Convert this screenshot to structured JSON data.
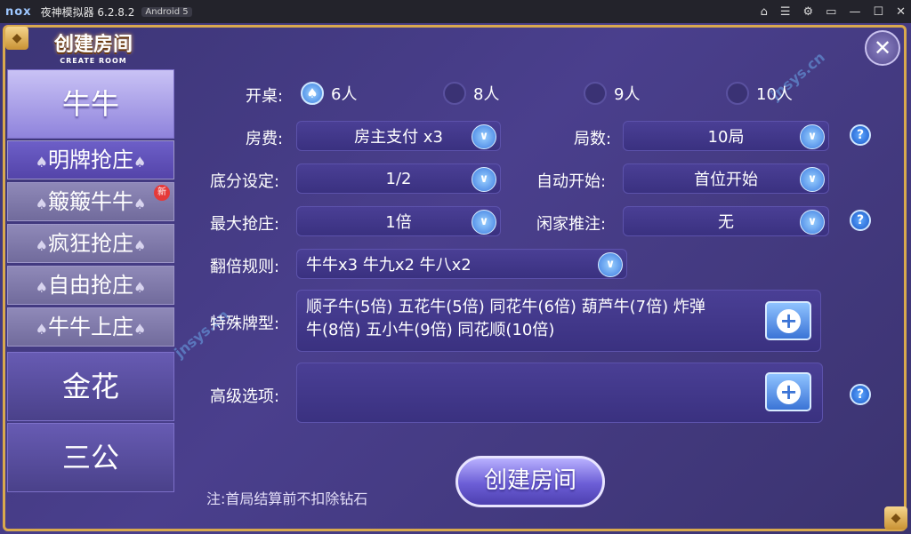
{
  "window": {
    "logo": "nox",
    "title": "夜神模拟器 6.2.8.2",
    "badge": "Android 5",
    "buttons": [
      "⌂",
      "☰",
      "⚙",
      "▭",
      "—",
      "☐",
      "✕"
    ]
  },
  "header": {
    "title_cn": "创建房间",
    "title_en": "CREATE ROOM"
  },
  "sidebar": {
    "niuniu": "牛牛",
    "sub_tabs": [
      "明牌抢庄",
      "簸簸牛牛",
      "疯狂抢庄",
      "自由抢庄",
      "牛牛上庄"
    ],
    "new_badge": "新",
    "jinhua": "金花",
    "sangong": "三公"
  },
  "form": {
    "table_label": "开桌:",
    "table_options": [
      "6人",
      "8人",
      "9人",
      "10人"
    ],
    "table_selected": "6人",
    "fee_label": "房费:",
    "fee_value": "房主支付 x3",
    "rounds_label": "局数:",
    "rounds_value": "10局",
    "base_label": "底分设定:",
    "base_value": "1/2",
    "autostart_label": "自动开始:",
    "autostart_value": "首位开始",
    "maxbank_label": "最大抢庄:",
    "maxbank_value": "1倍",
    "push_label": "闲家推注:",
    "push_value": "无",
    "double_label": "翻倍规则:",
    "double_value": "牛牛x3  牛九x2  牛八x2",
    "special_label": "特殊牌型:",
    "special_value": "顺子牛(5倍)  五花牛(5倍)  同花牛(6倍)  葫芦牛(7倍)  炸弹牛(8倍)  五小牛(9倍)  同花顺(10倍)",
    "advanced_label": "高级选项:",
    "advanced_value": ""
  },
  "create_button": "创建房间",
  "note": "注:首局结算前不扣除钻石",
  "watermark": "jnsys.cn",
  "icons": {
    "chevron": "∨",
    "help": "?",
    "plus": "+",
    "close": "✕",
    "spade": "♠"
  }
}
